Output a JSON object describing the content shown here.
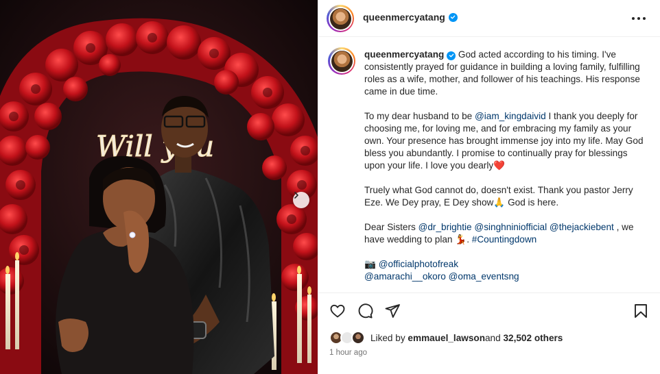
{
  "post": {
    "username": "queenmercyatang",
    "photo_sign_text": "Will you",
    "caption": {
      "p1": "God acted according to his timing. I've consistently prayed for guidance in building a loving family, fulfilling roles as a wife, mother, and follower of his teachings. His response came in due time.",
      "p2_a": "To my dear husband to be ",
      "p2_mention": "@iam_kingdaivid",
      "p2_b": " I thank you deeply for choosing me, for loving me, and for embracing my family as your own. Your presence has brought immense joy into my life. May God bless you abundantly. I promise to continually pray for blessings upon your life. I love you dearly",
      "p2_emoji": "❤️",
      "p3_a": "Truely what God cannot do, doesn't exist. Thank you pastor Jerry Eze. We Dey pray, E Dey show",
      "p3_emoji": "🙏",
      "p3_b": " God is here.",
      "p4_a": "Dear Sisters ",
      "p4_m1": "@dr_brightie",
      "p4_m2": "@singhniniofficial",
      "p4_m3": "@thejackiebent",
      "p4_b": " , we have wedding to plan ",
      "p4_emoji": "💃",
      "p4_c": ". ",
      "p4_hashtag": "#Countingdown",
      "p5_camera": "📷",
      "p5_m1": "@officialphotofreak",
      "p5_m2": "@amarachi__okoro",
      "p5_m3": "@oma_eventsng"
    },
    "likes": {
      "prefix": "Liked by ",
      "liker": "emmauel_lawson",
      "middle": " and ",
      "others": "32,502 others"
    },
    "timestamp": "1 hour ago"
  },
  "icons": {
    "verified": "verified-badge-icon",
    "more": "more-options-icon",
    "like": "heart-icon",
    "comment": "comment-icon",
    "share": "paper-plane-icon",
    "save": "bookmark-icon",
    "next": "chevron-right-icon"
  },
  "colors": {
    "link": "#00376b",
    "verified": "#0095f6",
    "muted": "#737373",
    "text": "#262626"
  }
}
